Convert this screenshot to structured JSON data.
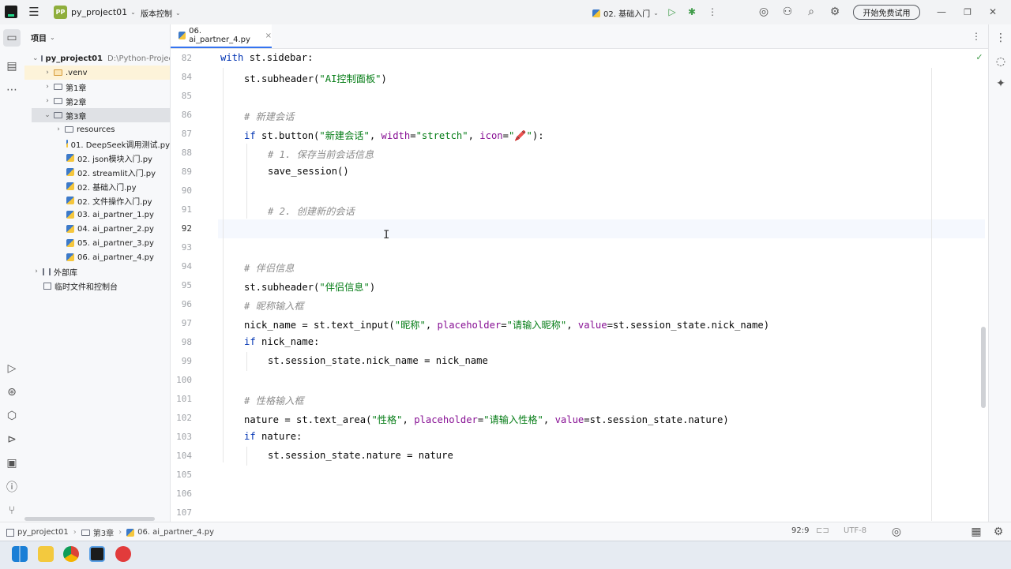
{
  "titlebar": {
    "project_badge": "PP",
    "project_name": "py_project01",
    "vcs_label": "版本控制",
    "run_config": "02. 基础入门",
    "trial_button": "开始免费试用"
  },
  "project_panel": {
    "title": "项目",
    "items": [
      {
        "label": "py_project01",
        "path": "D:\\Python-Project\\p"
      },
      {
        "label": ".venv"
      },
      {
        "label": "第1章"
      },
      {
        "label": "第2章"
      },
      {
        "label": "第3章"
      },
      {
        "label": "resources"
      },
      {
        "label": "01. DeepSeek调用测试.py"
      },
      {
        "label": "02. json模块入门.py"
      },
      {
        "label": "02. streamlit入门.py"
      },
      {
        "label": "02. 基础入门.py"
      },
      {
        "label": "02. 文件操作入门.py"
      },
      {
        "label": "03. ai_partner_1.py"
      },
      {
        "label": "04. ai_partner_2.py"
      },
      {
        "label": "05. ai_partner_3.py"
      },
      {
        "label": "06. ai_partner_4.py"
      },
      {
        "label": "外部库"
      },
      {
        "label": "临时文件和控制台"
      }
    ]
  },
  "editor": {
    "tab_label": "06. ai_partner_4.py",
    "tab_close": "×",
    "line_numbers": [
      "82",
      "84",
      "85",
      "86",
      "87",
      "88",
      "89",
      "90",
      "91",
      "92",
      "93",
      "94",
      "95",
      "96",
      "97",
      "98",
      "99",
      "100",
      "101",
      "102",
      "103",
      "104",
      "105",
      "106",
      "107"
    ],
    "code": {
      "l82_kw": "with",
      "l82_rest": " st.sidebar:",
      "l84_a": "st.subheader(",
      "l84_s": "\"AI控制面板\"",
      "l84_b": ")",
      "l86": "# 新建会话",
      "l87_kw": "if",
      "l87_a": " st.button(",
      "l87_s1": "\"新建会话\"",
      "l87_c1": ", ",
      "l87_p1": "width",
      "l87_eq1": "=",
      "l87_s2": "\"stretch\"",
      "l87_c2": ", ",
      "l87_p2": "icon",
      "l87_eq2": "=",
      "l87_s3": "\"🖍️\"",
      "l87_b": "):",
      "l88": "# 1. 保存当前会话信息",
      "l89": "save_session()",
      "l91": "# 2. 创建新的会话",
      "l94": "# 伴侣信息",
      "l95_a": "st.subheader(",
      "l95_s": "\"伴侣信息\"",
      "l95_b": ")",
      "l96": "# 昵称输入框",
      "l97_a": "nick_name = st.text_input(",
      "l97_s1": "\"昵称\"",
      "l97_c1": ", ",
      "l97_p1": "placeholder",
      "l97_eq1": "=",
      "l97_s2": "\"请输入昵称\"",
      "l97_c2": ", ",
      "l97_p2": "value",
      "l97_rest": "=st.session_state.nick_name)",
      "l98_kw": "if",
      "l98_rest": " nick_name:",
      "l99": "st.session_state.nick_name = nick_name",
      "l101": "# 性格输入框",
      "l102_a": "nature = st.text_area(",
      "l102_s1": "\"性格\"",
      "l102_c1": ", ",
      "l102_p1": "placeholder",
      "l102_eq1": "=",
      "l102_s2": "\"请输入性格\"",
      "l102_c2": ", ",
      "l102_p2": "value",
      "l102_rest": "=st.session_state.nature)",
      "l103_kw": "if",
      "l103_rest": " nature:",
      "l104": "st.session_state.nature = nature"
    }
  },
  "statusbar": {
    "crumb_project": "py_project01",
    "crumb_folder": "第3章",
    "crumb_file": "06. ai_partner_4.py",
    "position": "92:9",
    "encoding": "UTF-8"
  },
  "colors": {
    "accent": "#3574f0",
    "keyword": "#0033b3",
    "string": "#067d17",
    "param": "#871094",
    "comment": "#8c8c8c"
  }
}
